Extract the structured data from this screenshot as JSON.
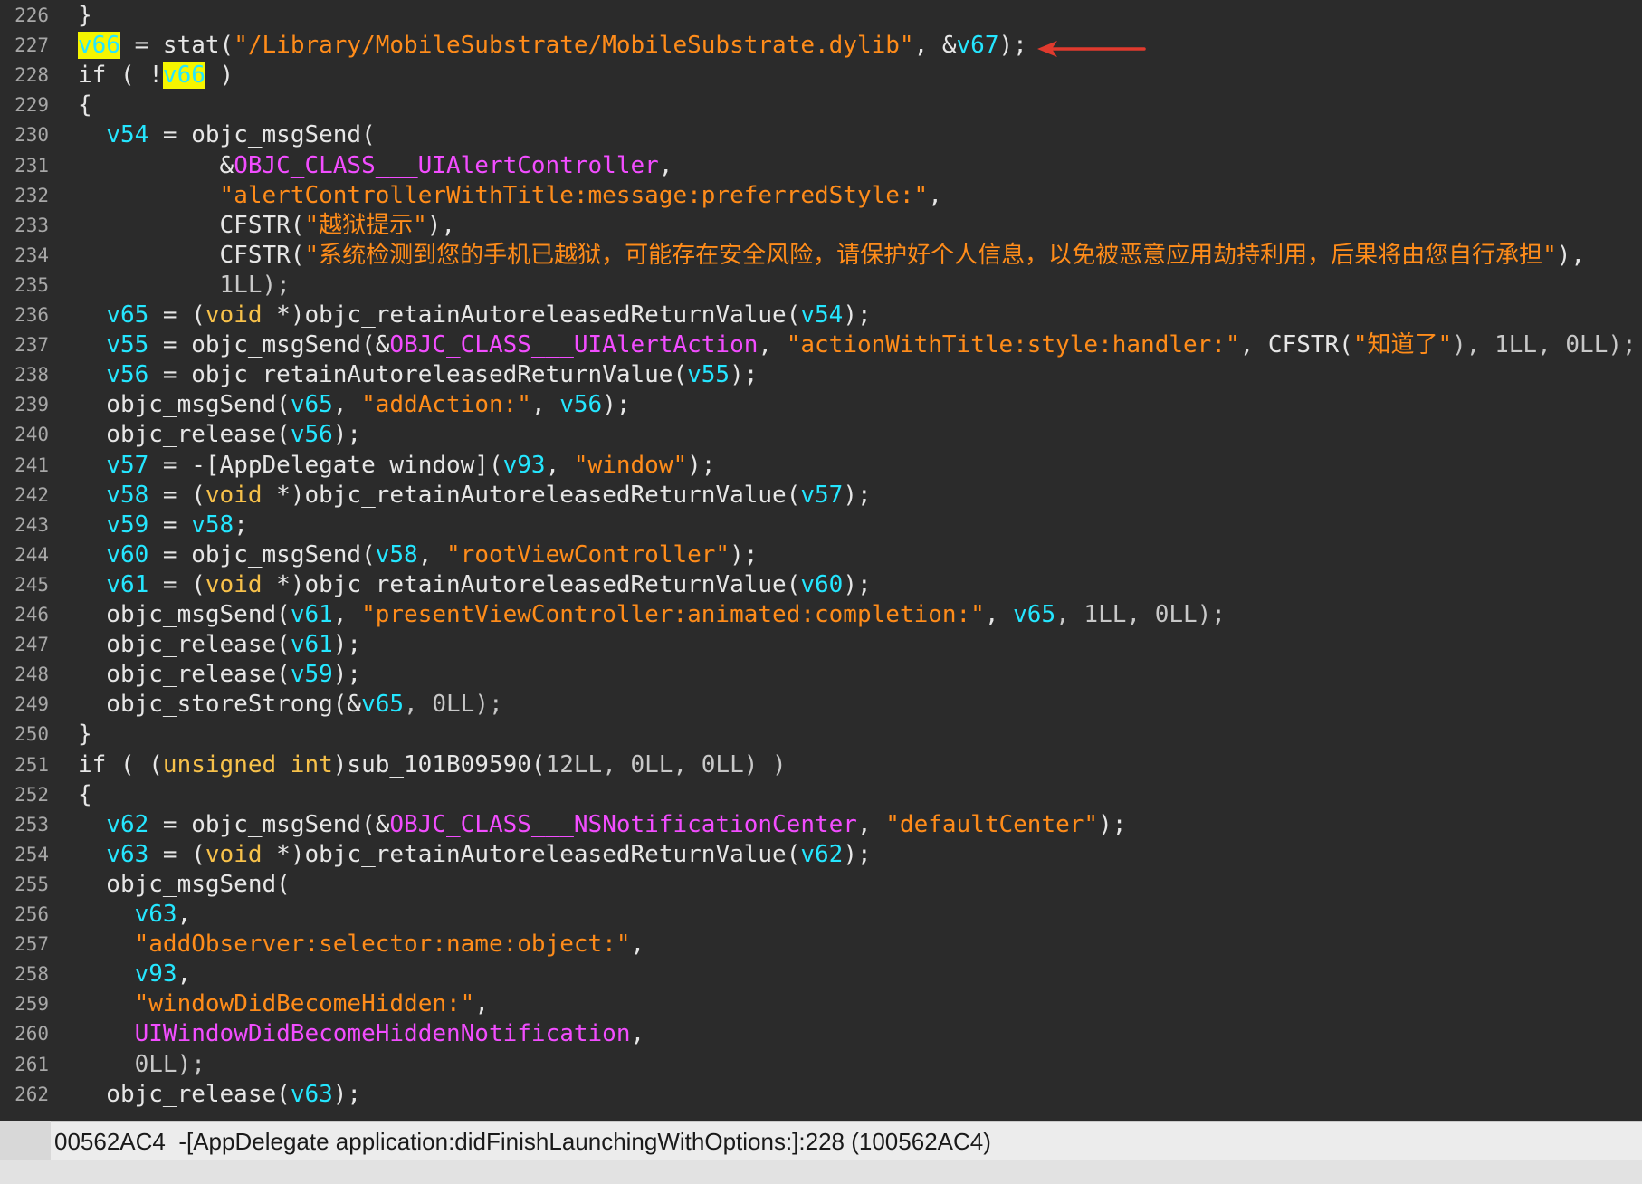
{
  "status_bar": {
    "text": "00562AC4  -[AppDelegate application:didFinishLaunchingWithOptions:]:228 (100562AC4)"
  },
  "colors": {
    "background": "#2b2b2b",
    "variable": "#25e6ff",
    "string": "#ff8c1a",
    "class_symbol": "#f24dff",
    "keyword_type": "#f7c14a",
    "highlight": "#f5f500",
    "annotation_arrow": "#e03a2e"
  },
  "annotation": {
    "icon": "red-arrow-icon",
    "points_to_line": "227"
  },
  "lines": [
    {
      "n": "226",
      "tokens": [
        {
          "t": "}",
          "c": "def"
        }
      ]
    },
    {
      "n": "227",
      "tokens": [
        {
          "t": "v66",
          "c": "hl"
        },
        {
          "t": " = stat(",
          "c": "def"
        },
        {
          "t": "\"/Library/MobileSubstrate/MobileSubstrate.dylib\"",
          "c": "str"
        },
        {
          "t": ", &",
          "c": "def"
        },
        {
          "t": "v67",
          "c": "var"
        },
        {
          "t": ");",
          "c": "def"
        }
      ]
    },
    {
      "n": "228",
      "tokens": [
        {
          "t": "if ( !",
          "c": "def"
        },
        {
          "t": "v66",
          "c": "hl"
        },
        {
          "t": " )",
          "c": "def"
        }
      ]
    },
    {
      "n": "229",
      "tokens": [
        {
          "t": "{",
          "c": "def"
        }
      ]
    },
    {
      "n": "230",
      "tokens": [
        {
          "t": "  ",
          "c": "def"
        },
        {
          "t": "v54",
          "c": "var"
        },
        {
          "t": " = objc_msgSend(",
          "c": "def"
        }
      ]
    },
    {
      "n": "231",
      "tokens": [
        {
          "t": "          &",
          "c": "def"
        },
        {
          "t": "OBJC_CLASS___UIAlertController",
          "c": "mag"
        },
        {
          "t": ",",
          "c": "def"
        }
      ]
    },
    {
      "n": "232",
      "tokens": [
        {
          "t": "          ",
          "c": "def"
        },
        {
          "t": "\"alertControllerWithTitle:message:preferredStyle:\"",
          "c": "str"
        },
        {
          "t": ",",
          "c": "def"
        }
      ]
    },
    {
      "n": "233",
      "tokens": [
        {
          "t": "          CFSTR(",
          "c": "def"
        },
        {
          "t": "\"越狱提示\"",
          "c": "str"
        },
        {
          "t": "),",
          "c": "def"
        }
      ]
    },
    {
      "n": "234",
      "tokens": [
        {
          "t": "          CFSTR(",
          "c": "def"
        },
        {
          "t": "\"系统检测到您的手机已越狱，可能存在安全风险，请保护好个人信息，以免被恶意应用劫持利用，后果将由您自行承担\"",
          "c": "str"
        },
        {
          "t": "),",
          "c": "def"
        }
      ]
    },
    {
      "n": "235",
      "tokens": [
        {
          "t": "          1LL);",
          "c": "num"
        }
      ]
    },
    {
      "n": "236",
      "tokens": [
        {
          "t": "  ",
          "c": "def"
        },
        {
          "t": "v65",
          "c": "var"
        },
        {
          "t": " = (",
          "c": "def"
        },
        {
          "t": "void",
          "c": "key"
        },
        {
          "t": " *)objc_retainAutoreleasedReturnValue(",
          "c": "def"
        },
        {
          "t": "v54",
          "c": "var"
        },
        {
          "t": ");",
          "c": "def"
        }
      ]
    },
    {
      "n": "237",
      "tokens": [
        {
          "t": "  ",
          "c": "def"
        },
        {
          "t": "v55",
          "c": "var"
        },
        {
          "t": " = objc_msgSend(&",
          "c": "def"
        },
        {
          "t": "OBJC_CLASS___UIAlertAction",
          "c": "mag"
        },
        {
          "t": ", ",
          "c": "def"
        },
        {
          "t": "\"actionWithTitle:style:handler:\"",
          "c": "str"
        },
        {
          "t": ", CFSTR(",
          "c": "def"
        },
        {
          "t": "\"知道了\"",
          "c": "str"
        },
        {
          "t": "), 1LL, 0LL);",
          "c": "num"
        }
      ]
    },
    {
      "n": "238",
      "tokens": [
        {
          "t": "  ",
          "c": "def"
        },
        {
          "t": "v56",
          "c": "var"
        },
        {
          "t": " = objc_retainAutoreleasedReturnValue(",
          "c": "def"
        },
        {
          "t": "v55",
          "c": "var"
        },
        {
          "t": ");",
          "c": "def"
        }
      ]
    },
    {
      "n": "239",
      "tokens": [
        {
          "t": "  objc_msgSend(",
          "c": "def"
        },
        {
          "t": "v65",
          "c": "var"
        },
        {
          "t": ", ",
          "c": "def"
        },
        {
          "t": "\"addAction:\"",
          "c": "str"
        },
        {
          "t": ", ",
          "c": "def"
        },
        {
          "t": "v56",
          "c": "var"
        },
        {
          "t": ");",
          "c": "def"
        }
      ]
    },
    {
      "n": "240",
      "tokens": [
        {
          "t": "  objc_release(",
          "c": "def"
        },
        {
          "t": "v56",
          "c": "var"
        },
        {
          "t": ");",
          "c": "def"
        }
      ]
    },
    {
      "n": "241",
      "tokens": [
        {
          "t": "  ",
          "c": "def"
        },
        {
          "t": "v57",
          "c": "var"
        },
        {
          "t": " = -[AppDelegate window](",
          "c": "def"
        },
        {
          "t": "v93",
          "c": "var"
        },
        {
          "t": ", ",
          "c": "def"
        },
        {
          "t": "\"window\"",
          "c": "str"
        },
        {
          "t": ");",
          "c": "def"
        }
      ]
    },
    {
      "n": "242",
      "tokens": [
        {
          "t": "  ",
          "c": "def"
        },
        {
          "t": "v58",
          "c": "var"
        },
        {
          "t": " = (",
          "c": "def"
        },
        {
          "t": "void",
          "c": "key"
        },
        {
          "t": " *)objc_retainAutoreleasedReturnValue(",
          "c": "def"
        },
        {
          "t": "v57",
          "c": "var"
        },
        {
          "t": ");",
          "c": "def"
        }
      ]
    },
    {
      "n": "243",
      "tokens": [
        {
          "t": "  ",
          "c": "def"
        },
        {
          "t": "v59",
          "c": "var"
        },
        {
          "t": " = ",
          "c": "def"
        },
        {
          "t": "v58",
          "c": "var"
        },
        {
          "t": ";",
          "c": "def"
        }
      ]
    },
    {
      "n": "244",
      "tokens": [
        {
          "t": "  ",
          "c": "def"
        },
        {
          "t": "v60",
          "c": "var"
        },
        {
          "t": " = objc_msgSend(",
          "c": "def"
        },
        {
          "t": "v58",
          "c": "var"
        },
        {
          "t": ", ",
          "c": "def"
        },
        {
          "t": "\"rootViewController\"",
          "c": "str"
        },
        {
          "t": ");",
          "c": "def"
        }
      ]
    },
    {
      "n": "245",
      "tokens": [
        {
          "t": "  ",
          "c": "def"
        },
        {
          "t": "v61",
          "c": "var"
        },
        {
          "t": " = (",
          "c": "def"
        },
        {
          "t": "void",
          "c": "key"
        },
        {
          "t": " *)objc_retainAutoreleasedReturnValue(",
          "c": "def"
        },
        {
          "t": "v60",
          "c": "var"
        },
        {
          "t": ");",
          "c": "def"
        }
      ]
    },
    {
      "n": "246",
      "tokens": [
        {
          "t": "  objc_msgSend(",
          "c": "def"
        },
        {
          "t": "v61",
          "c": "var"
        },
        {
          "t": ", ",
          "c": "def"
        },
        {
          "t": "\"presentViewController:animated:completion:\"",
          "c": "str"
        },
        {
          "t": ", ",
          "c": "def"
        },
        {
          "t": "v65",
          "c": "var"
        },
        {
          "t": ", 1LL, 0LL);",
          "c": "num"
        }
      ]
    },
    {
      "n": "247",
      "tokens": [
        {
          "t": "  objc_release(",
          "c": "def"
        },
        {
          "t": "v61",
          "c": "var"
        },
        {
          "t": ");",
          "c": "def"
        }
      ]
    },
    {
      "n": "248",
      "tokens": [
        {
          "t": "  objc_release(",
          "c": "def"
        },
        {
          "t": "v59",
          "c": "var"
        },
        {
          "t": ");",
          "c": "def"
        }
      ]
    },
    {
      "n": "249",
      "tokens": [
        {
          "t": "  objc_storeStrong(&",
          "c": "def"
        },
        {
          "t": "v65",
          "c": "var"
        },
        {
          "t": ", 0LL);",
          "c": "num"
        }
      ]
    },
    {
      "n": "250",
      "tokens": [
        {
          "t": "}",
          "c": "def"
        }
      ]
    },
    {
      "n": "251",
      "tokens": [
        {
          "t": "if ( (",
          "c": "def"
        },
        {
          "t": "unsigned int",
          "c": "key"
        },
        {
          "t": ")sub_101B09590(",
          "c": "def"
        },
        {
          "t": "12LL, 0LL, 0LL) )",
          "c": "num"
        }
      ]
    },
    {
      "n": "252",
      "tokens": [
        {
          "t": "{",
          "c": "def"
        }
      ]
    },
    {
      "n": "253",
      "tokens": [
        {
          "t": "  ",
          "c": "def"
        },
        {
          "t": "v62",
          "c": "var"
        },
        {
          "t": " = objc_msgSend(&",
          "c": "def"
        },
        {
          "t": "OBJC_CLASS___NSNotificationCenter",
          "c": "mag"
        },
        {
          "t": ", ",
          "c": "def"
        },
        {
          "t": "\"defaultCenter\"",
          "c": "str"
        },
        {
          "t": ");",
          "c": "def"
        }
      ]
    },
    {
      "n": "254",
      "tokens": [
        {
          "t": "  ",
          "c": "def"
        },
        {
          "t": "v63",
          "c": "var"
        },
        {
          "t": " = (",
          "c": "def"
        },
        {
          "t": "void",
          "c": "key"
        },
        {
          "t": " *)objc_retainAutoreleasedReturnValue(",
          "c": "def"
        },
        {
          "t": "v62",
          "c": "var"
        },
        {
          "t": ");",
          "c": "def"
        }
      ]
    },
    {
      "n": "255",
      "tokens": [
        {
          "t": "  objc_msgSend(",
          "c": "def"
        }
      ]
    },
    {
      "n": "256",
      "tokens": [
        {
          "t": "    ",
          "c": "def"
        },
        {
          "t": "v63",
          "c": "var"
        },
        {
          "t": ",",
          "c": "def"
        }
      ]
    },
    {
      "n": "257",
      "tokens": [
        {
          "t": "    ",
          "c": "def"
        },
        {
          "t": "\"addObserver:selector:name:object:\"",
          "c": "str"
        },
        {
          "t": ",",
          "c": "def"
        }
      ]
    },
    {
      "n": "258",
      "tokens": [
        {
          "t": "    ",
          "c": "def"
        },
        {
          "t": "v93",
          "c": "var"
        },
        {
          "t": ",",
          "c": "def"
        }
      ]
    },
    {
      "n": "259",
      "tokens": [
        {
          "t": "    ",
          "c": "def"
        },
        {
          "t": "\"windowDidBecomeHidden:\"",
          "c": "str"
        },
        {
          "t": ",",
          "c": "def"
        }
      ]
    },
    {
      "n": "260",
      "tokens": [
        {
          "t": "    ",
          "c": "def"
        },
        {
          "t": "UIWindowDidBecomeHiddenNotification",
          "c": "mag"
        },
        {
          "t": ",",
          "c": "def"
        }
      ]
    },
    {
      "n": "261",
      "tokens": [
        {
          "t": "    0LL);",
          "c": "num"
        }
      ]
    },
    {
      "n": "262",
      "tokens": [
        {
          "t": "  objc_release(",
          "c": "def"
        },
        {
          "t": "v63",
          "c": "var"
        },
        {
          "t": ");",
          "c": "def"
        }
      ]
    }
  ]
}
